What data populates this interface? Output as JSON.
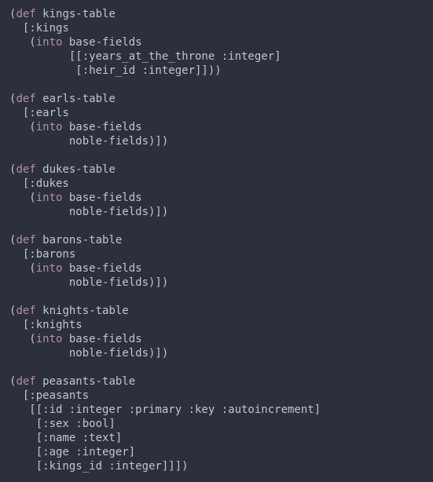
{
  "lines": [
    "(def kings-table",
    "  [:kings",
    "   (into base-fields",
    "         [[:years_at_the_throne :integer]",
    "          [:heir_id :integer]]))",
    "",
    "(def earls-table",
    "  [:earls",
    "   (into base-fields",
    "         noble-fields)])",
    "",
    "(def dukes-table",
    "  [:dukes",
    "   (into base-fields",
    "         noble-fields)])",
    "",
    "(def barons-table",
    "  [:barons",
    "   (into base-fields",
    "         noble-fields)])",
    "",
    "(def knights-table",
    "  [:knights",
    "   (into base-fields",
    "         noble-fields)])",
    "",
    "(def peasants-table",
    "  [:peasants",
    "   [[:id :integer :primary :key :autoincrement]",
    "    [:sex :bool]",
    "    [:name :text]",
    "    [:age :integer]",
    "    [:kings_id :integer]]])"
  ]
}
